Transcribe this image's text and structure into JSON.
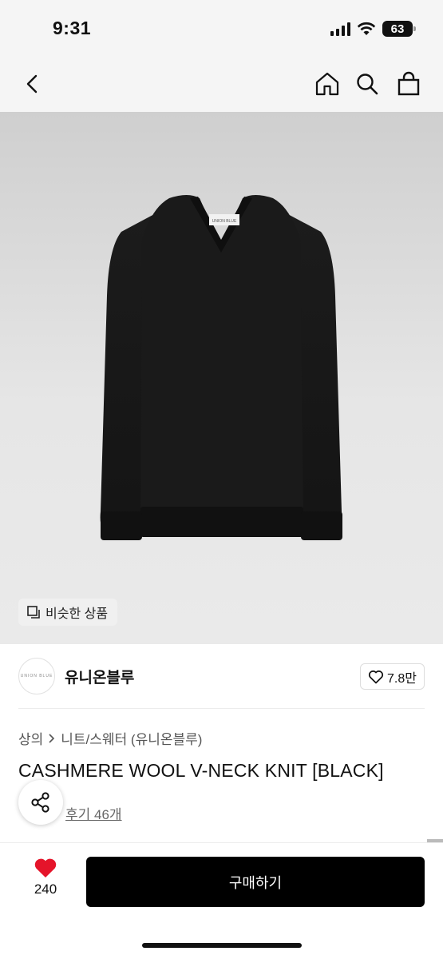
{
  "status_bar": {
    "time": "9:31",
    "battery": "63"
  },
  "icons": {
    "back": "chevron-left-icon",
    "home": "home-icon",
    "search": "search-icon",
    "cart": "shopping-bag-icon",
    "similar": "copy-icon",
    "like": "heart-outline-icon",
    "wish": "heart-filled-icon",
    "share": "share-icon"
  },
  "image": {
    "label_tag": "UNION BLUE",
    "similar_button": "비슷한 상품"
  },
  "brand": {
    "logo_text": "UNION BLUE",
    "name": "유니온블루",
    "likes": "7.8만"
  },
  "product": {
    "breadcrumb": [
      "상의",
      "니트/스웨터 (유니온블루)"
    ],
    "title": "CASHMERE WOOL V-NECK KNIT [BLACK]",
    "reviews": "후기 46개"
  },
  "bottom_bar": {
    "wish_count": "240",
    "buy_label": "구매하기"
  },
  "colors": {
    "accent": "#e5142a",
    "buy_button": "#000000"
  }
}
